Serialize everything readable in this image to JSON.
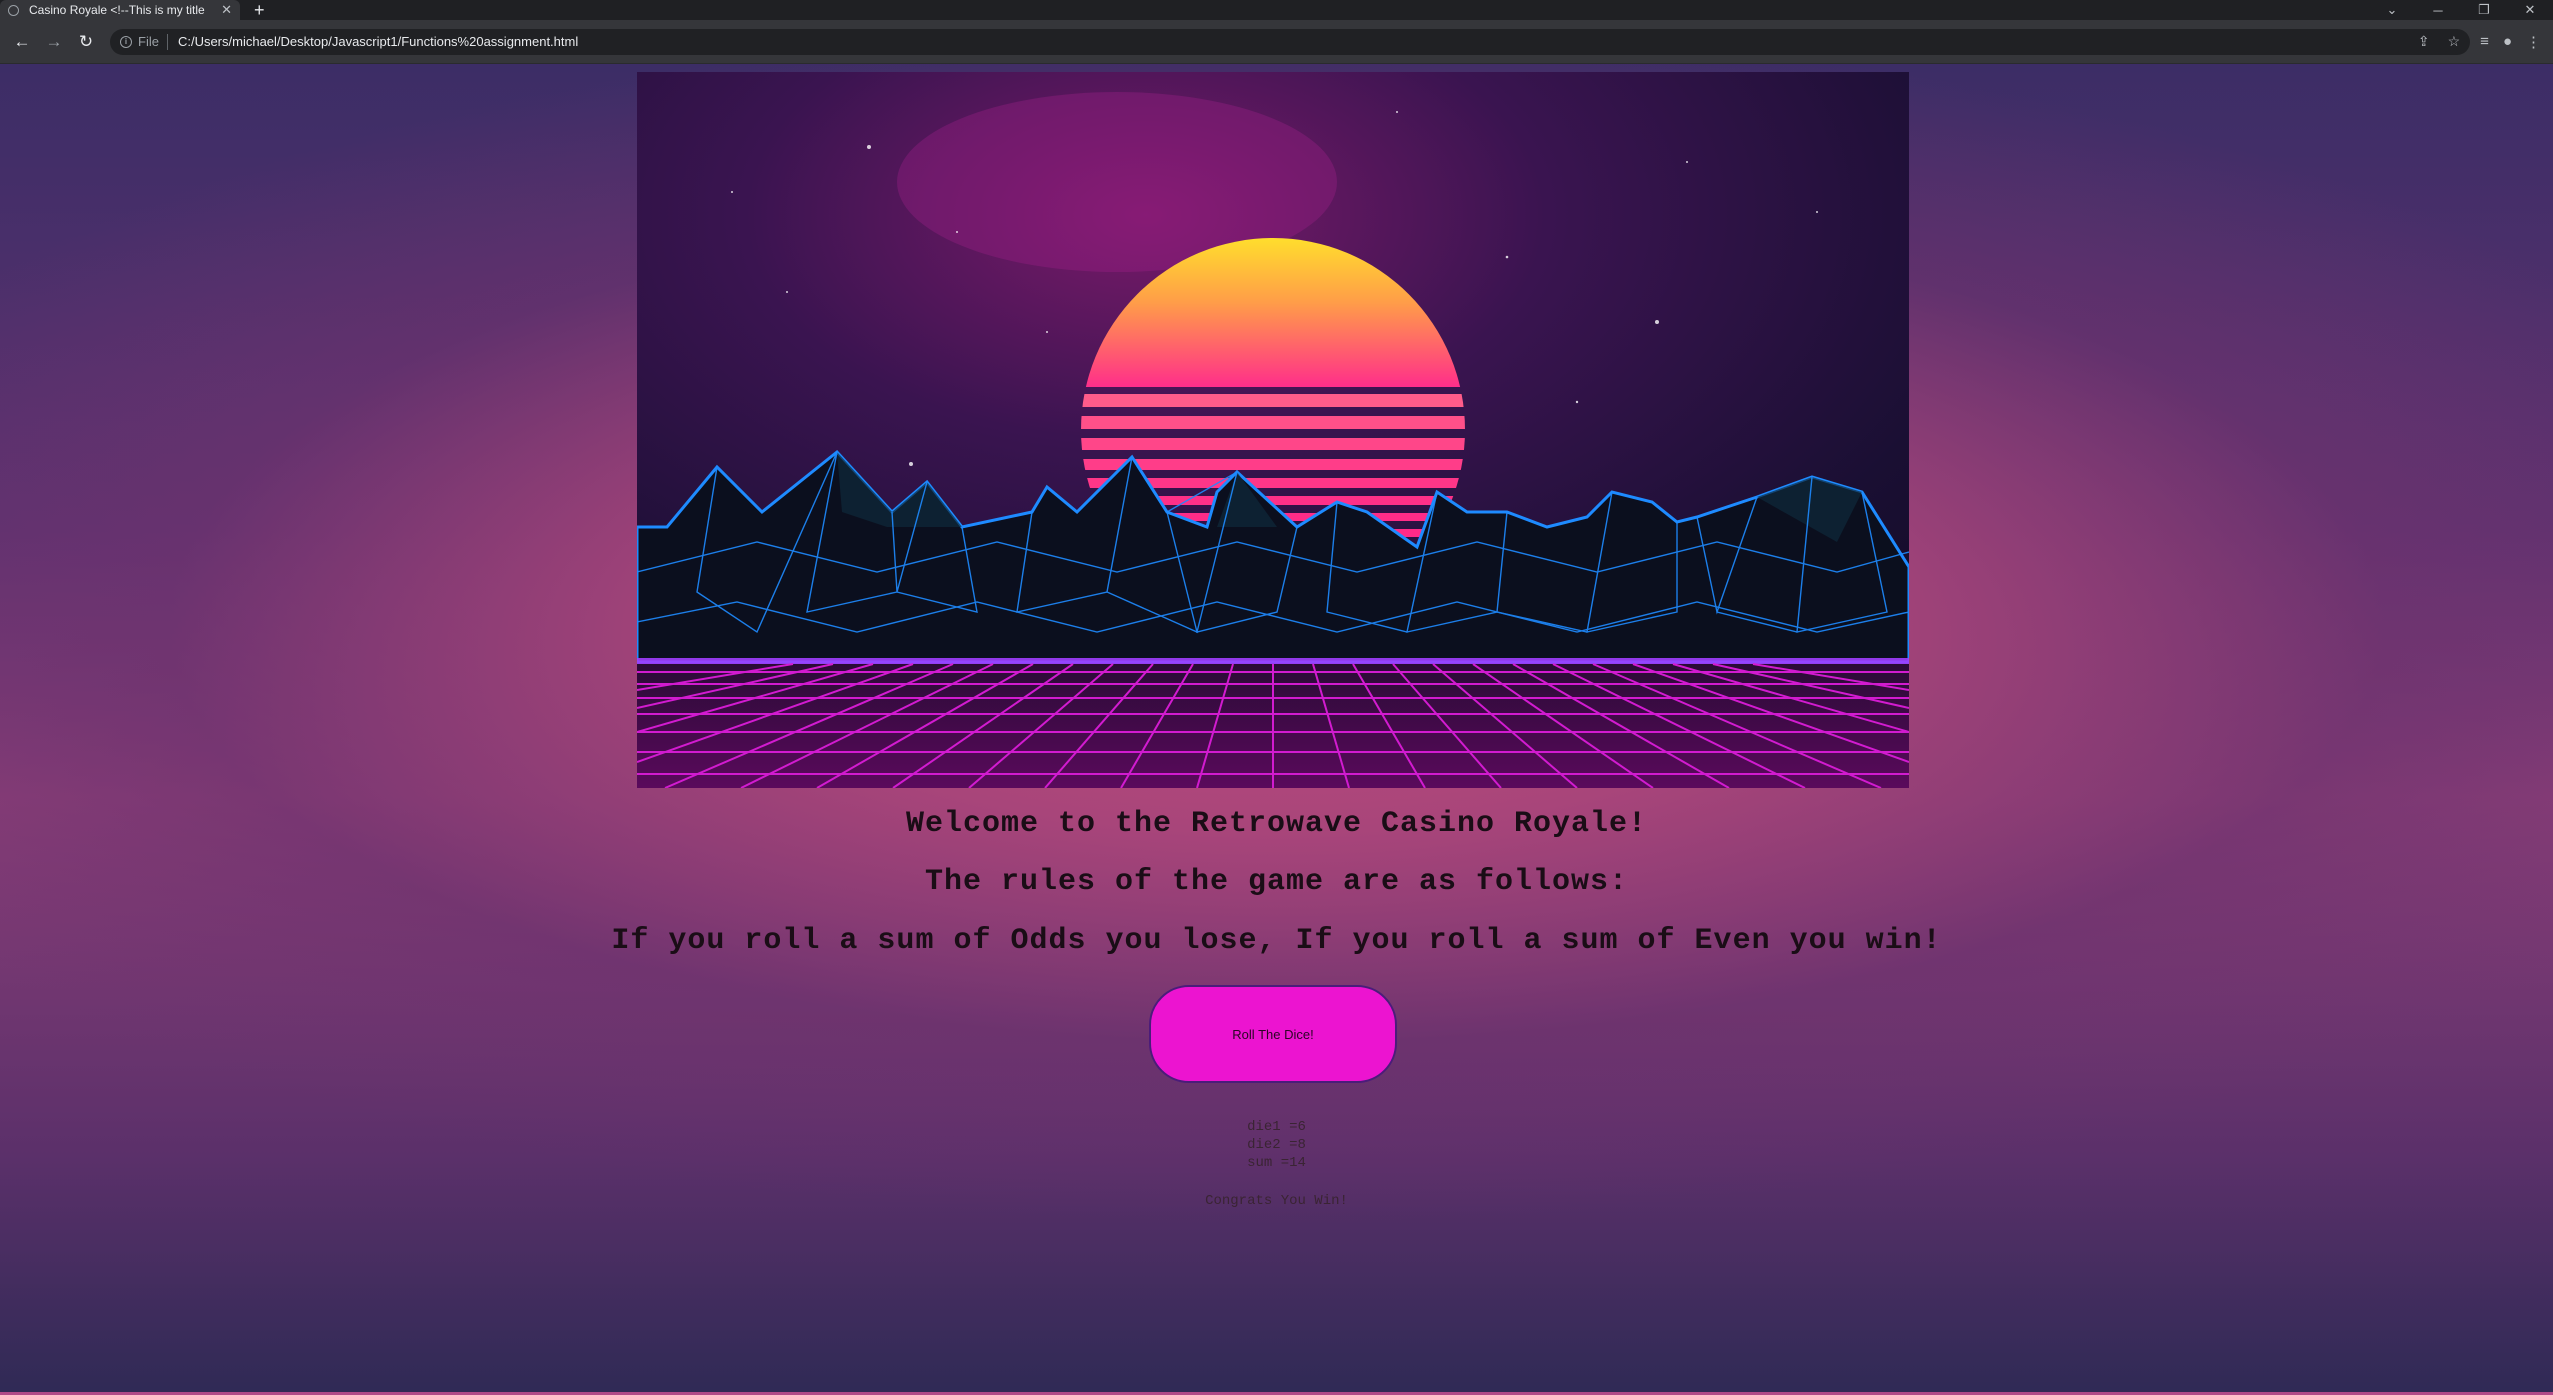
{
  "browser": {
    "tab_title": "Casino Royale <!--This is my title",
    "scheme_label": "File",
    "url": "C:/Users/michael/Desktop/Javascript1/Functions%20assignment.html"
  },
  "page": {
    "welcome": "Welcome to the Retrowave Casino Royale!",
    "rules_intro": "The rules of the game are as follows:",
    "rules": "If you roll a sum of Odds you lose, If you roll a sum of Even you win!",
    "roll_button": "Roll The Dice!",
    "die1": "die1 =6",
    "die2": "die2 =8",
    "sum": "sum =14",
    "result_message": "Congrats You Win!"
  },
  "colors": {
    "button": "#ec14d0",
    "sun_top": "#ffd530",
    "sun_bottom": "#ff3f87",
    "grid": "#d21bd0",
    "mountain_wire": "#1e8bff"
  }
}
